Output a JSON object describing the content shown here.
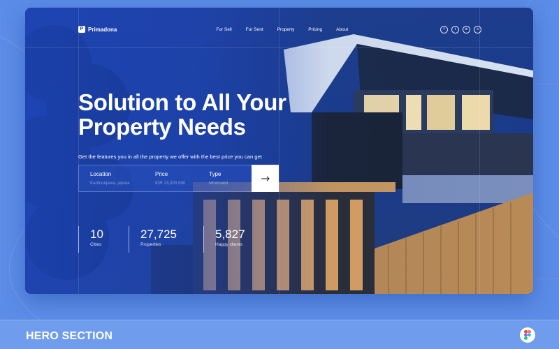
{
  "brand": {
    "name": "Primadona",
    "logo_letter": "P"
  },
  "nav": {
    "items": [
      "For Sell",
      "For Sent",
      "Property",
      "Pricing",
      "About"
    ]
  },
  "social": {
    "icons": [
      "facebook-icon",
      "twitter-icon",
      "linkedin-icon",
      "instagram-icon"
    ],
    "glyphs": [
      "f",
      "t",
      "in",
      "o"
    ]
  },
  "hero": {
    "title_line1": "Solution to All Your",
    "title_line2": "Property Needs",
    "subtitle": "Get the features you in all the property we offer with the best price you can get"
  },
  "search": {
    "fields": [
      {
        "label": "Location",
        "value": "Karimunjawa, jepara"
      },
      {
        "label": "Price",
        "value": "IDR 13,000,000"
      },
      {
        "label": "Type",
        "value": "Minimalist"
      }
    ]
  },
  "stats": [
    {
      "value": "10",
      "label": "Cities"
    },
    {
      "value": "27,725",
      "label": "Properties"
    },
    {
      "value": "5,827",
      "label": "Happy clients"
    }
  ],
  "footer": {
    "title": "HERO SECTION",
    "figma_icon": "figma-icon"
  },
  "colors": {
    "background": "#5b8de8",
    "card_overlay": "#1e46be",
    "accent_white": "#ffffff"
  }
}
